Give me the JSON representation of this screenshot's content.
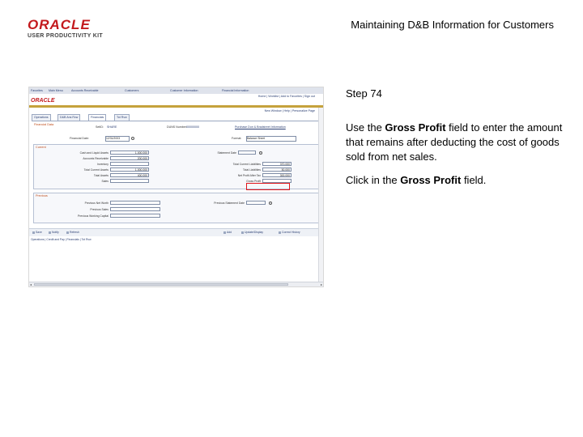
{
  "header": {
    "logo_brand": "ORACLE",
    "logo_product": "USER PRODUCTIVITY KIT",
    "title": "Maintaining D&B Information for Customers"
  },
  "instructions": {
    "step": "Step 74",
    "line1_pre": "Use the ",
    "line1_bold": "Gross Profit",
    "line1_post": " field to enter the amount that remains after deducting the cost of goods sold from net sales.",
    "line2_pre": "Click in the ",
    "line2_bold": "Gross Profit",
    "line2_post": " field."
  },
  "screenshot": {
    "menubar": [
      "Favorites",
      "Main Menu",
      "Accounts Receivable",
      "Customers",
      "Customer Information",
      "Financial Information"
    ],
    "navlinks": "Home | Worklist | Add to Favorites | Sign out",
    "brand": "ORACLE",
    "toplinks": "New Window | Help | Personalize Page",
    "tabs": [
      "Operations",
      "D&B Ans Rvw",
      "Financials",
      "Tot Rvw"
    ],
    "section_label": "Financial Data",
    "setid_label": "SetID:",
    "setid_value": "SHARE",
    "duns_label": "DUNS Number:",
    "duns_value": "00000000",
    "purchase_label": "Purchase Dun & Bradstreet Information",
    "period_label": "Financial Date:",
    "period_value": "12/31/2003",
    "format_label": "Format:",
    "format_value": "Balance Sheet",
    "current_title": "Current",
    "current_left": [
      {
        "label": "Cash and Liquid Assets",
        "value": "1,000,000"
      },
      {
        "label": "Accounts Receivable",
        "value": "200,000"
      },
      {
        "label": "Inventory",
        "value": ""
      },
      {
        "label": "Total Current Assets",
        "value": "1,000,000"
      },
      {
        "label": "Total Assets",
        "value": "400,000"
      },
      {
        "label": "Sales",
        "value": ""
      }
    ],
    "current_right": [
      {
        "label": "Statement Date",
        "value": ""
      },
      {
        "label": "Total Current Liabilities",
        "value": "370,000"
      },
      {
        "label": "Total Liabilities",
        "value": "50,000"
      },
      {
        "label": "Net Profit After Tax",
        "value": "300,000"
      },
      {
        "label": "Gross Profit",
        "value": ""
      }
    ],
    "previous_title": "Previous",
    "previous_left": [
      {
        "label": "Previous Net Worth",
        "value": ""
      },
      {
        "label": "Previous Sales",
        "value": ""
      },
      {
        "label": "Previous Working Capital",
        "value": ""
      }
    ],
    "previous_right": [
      {
        "label": "Previous Statement Date",
        "value": ""
      }
    ],
    "buttons_left": [
      "Save",
      "Notify",
      "Refresh"
    ],
    "buttons_right": [
      "Add",
      "Update/Display",
      "Correct History"
    ],
    "footer_links": "Operations | Credit and Pay | Financials | Tot Rvw"
  }
}
